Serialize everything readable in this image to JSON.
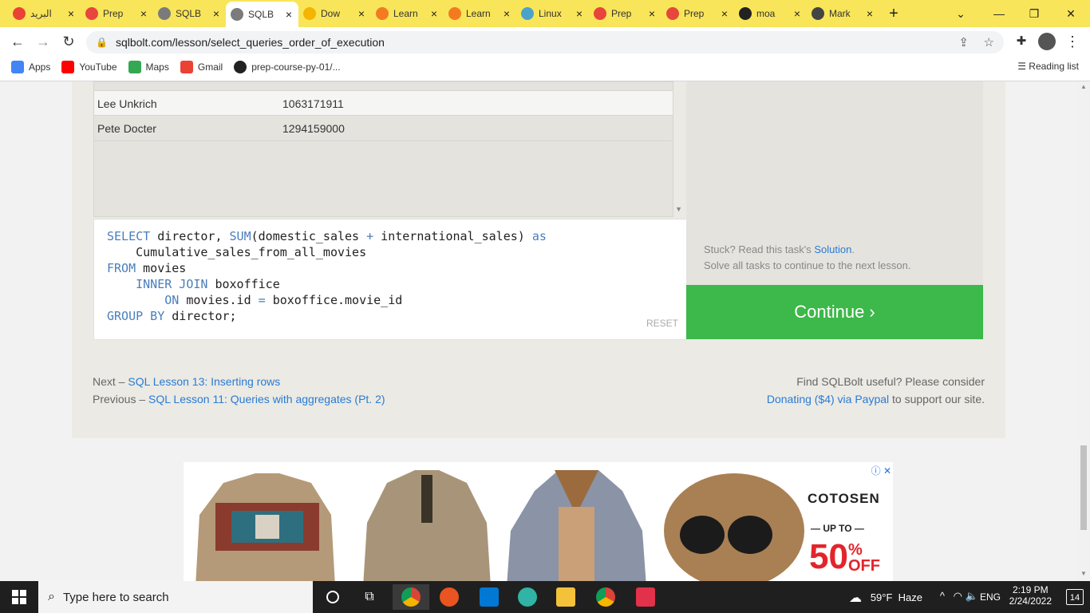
{
  "browser": {
    "tabs": [
      {
        "title": "البريد",
        "color": "#ea4335"
      },
      {
        "title": "Prep",
        "color": "#e8453c"
      },
      {
        "title": "SQLB",
        "color": "#7b7b7b"
      },
      {
        "title": "SQLB",
        "color": "#7b7b7b"
      },
      {
        "title": "Dow",
        "color": "#f4b400"
      },
      {
        "title": "Learn",
        "color": "#f47a20"
      },
      {
        "title": "Learn",
        "color": "#f47a20"
      },
      {
        "title": "Linux",
        "color": "#4aa3c8"
      },
      {
        "title": "Prep",
        "color": "#e8453c"
      },
      {
        "title": "Prep",
        "color": "#e8453c"
      },
      {
        "title": "moa",
        "color": "#222222"
      },
      {
        "title": "Mark",
        "color": "#444444"
      }
    ],
    "url": "sqlbolt.com/lesson/select_queries_order_of_execution",
    "bookmarks": [
      {
        "label": "Apps",
        "icon": "apps-grid-icon"
      },
      {
        "label": "YouTube",
        "icon": "youtube-icon"
      },
      {
        "label": "Maps",
        "icon": "maps-icon"
      },
      {
        "label": "Gmail",
        "icon": "gmail-icon"
      },
      {
        "label": "prep-course-py-01/...",
        "icon": "github-icon"
      }
    ],
    "reading_list": "Reading list"
  },
  "results": {
    "rows": [
      {
        "director": "Lee Unkrich",
        "sales": "1063171911"
      },
      {
        "director": "Pete Docter",
        "sales": "1294159000"
      }
    ]
  },
  "editor": {
    "line1_kw1": "SELECT",
    "line1_text": " director, ",
    "line1_kw2": "SUM",
    "line1_text2": "(domestic_sales ",
    "line1_op": "+",
    "line1_text3": " international_sales) ",
    "line1_kw3": "as",
    "line2": "    Cumulative_sales_from_all_movies",
    "line3_kw": "FROM",
    "line3_text": " movies",
    "line4_kw": "    INNER JOIN",
    "line4_text": " boxoffice",
    "line5_kw": "        ON",
    "line5_text": " movies.id ",
    "line5_op": "=",
    "line5_text2": " boxoffice.movie_id",
    "line6_kw": "GROUP BY",
    "line6_text": " director;",
    "reset": "RESET"
  },
  "hint": {
    "stuck": "Stuck? Read this task's ",
    "solution": "Solution",
    "stuck_end": ".",
    "solve": "Solve all tasks to continue to the next lesson."
  },
  "continue_label": "Continue ›",
  "footer": {
    "next_prefix": "Next – ",
    "next_link": "SQL Lesson 13: Inserting rows",
    "prev_prefix": "Previous – ",
    "prev_link": "SQL Lesson 11: Queries with aggregates (Pt. 2)",
    "useful": "Find SQLBolt useful? Please consider",
    "donate_link": "Donating ($4) via Paypal",
    "donate_suffix": " to support our site."
  },
  "ad": {
    "brand": "COTOSEN",
    "up_to": "— UP TO —",
    "percent": "50",
    "percent_sign": "%",
    "off": "OFF"
  },
  "taskbar": {
    "search_placeholder": "Type here to search",
    "weather": "59°F  Haze",
    "lang": "ENG",
    "time": "2:19 PM",
    "date": "2/24/2022",
    "notifications": "14"
  }
}
